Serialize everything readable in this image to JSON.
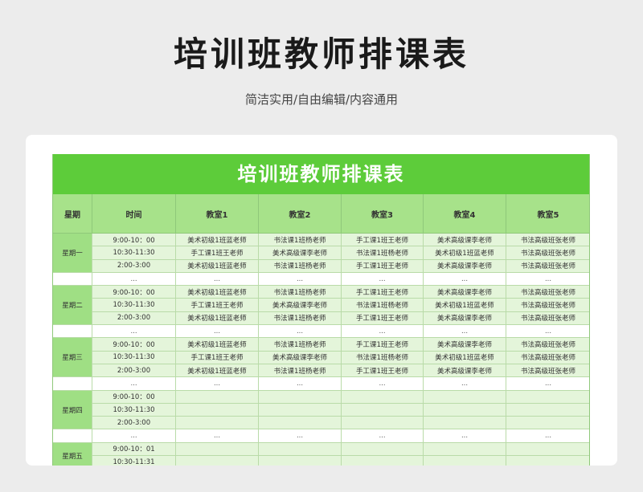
{
  "page": {
    "title": "培训班教师排课表",
    "subtitle": "简洁实用/自由编辑/内容通用"
  },
  "sheet": {
    "banner": "培训班教师排课表",
    "headers": [
      "星期",
      "时间",
      "教室1",
      "教室2",
      "教室3",
      "教室4",
      "教室5"
    ],
    "ellipsis": "...",
    "days": [
      {
        "day": "星期一",
        "rows": [
          {
            "time": "9:00-10：00",
            "cells": [
              "美术初级1班蓝老师",
              "书法课1班杨老师",
              "手工课1班王老师",
              "美术高级课李老师",
              "书法高级班张老师"
            ]
          },
          {
            "time": "10:30-11:30",
            "cells": [
              "手工课1班王老师",
              "美术高级课李老师",
              "书法课1班杨老师",
              "美术初级1班蓝老师",
              "书法高级班张老师"
            ]
          },
          {
            "time": "2:00-3:00",
            "cells": [
              "美术初级1班蓝老师",
              "书法课1班杨老师",
              "手工课1班王老师",
              "美术高级课李老师",
              "书法高级班张老师"
            ]
          }
        ]
      },
      {
        "day": "星期二",
        "rows": [
          {
            "time": "9:00-10：00",
            "cells": [
              "美术初级1班蓝老师",
              "书法课1班杨老师",
              "手工课1班王老师",
              "美术高级课李老师",
              "书法高级班张老师"
            ]
          },
          {
            "time": "10:30-11:30",
            "cells": [
              "手工课1班王老师",
              "美术高级课李老师",
              "书法课1班杨老师",
              "美术初级1班蓝老师",
              "书法高级班张老师"
            ]
          },
          {
            "time": "2:00-3:00",
            "cells": [
              "美术初级1班蓝老师",
              "书法课1班杨老师",
              "手工课1班王老师",
              "美术高级课李老师",
              "书法高级班张老师"
            ]
          }
        ]
      },
      {
        "day": "星期三",
        "rows": [
          {
            "time": "9:00-10：00",
            "cells": [
              "美术初级1班蓝老师",
              "书法课1班杨老师",
              "手工课1班王老师",
              "美术高级课李老师",
              "书法高级班张老师"
            ]
          },
          {
            "time": "10:30-11:30",
            "cells": [
              "手工课1班王老师",
              "美术高级课李老师",
              "书法课1班杨老师",
              "美术初级1班蓝老师",
              "书法高级班张老师"
            ]
          },
          {
            "time": "2:00-3:00",
            "cells": [
              "美术初级1班蓝老师",
              "书法课1班杨老师",
              "手工课1班王老师",
              "美术高级课李老师",
              "书法高级班张老师"
            ]
          }
        ]
      },
      {
        "day": "星期四",
        "rows": [
          {
            "time": "9:00-10：00",
            "cells": [
              "",
              "",
              "",
              "",
              ""
            ]
          },
          {
            "time": "10:30-11:30",
            "cells": [
              "",
              "",
              "",
              "",
              ""
            ]
          },
          {
            "time": "2:00-3:00",
            "cells": [
              "",
              "",
              "",
              "",
              ""
            ]
          }
        ]
      },
      {
        "day": "星期五",
        "rows": [
          {
            "time": "9:00-10：01",
            "cells": [
              "",
              "",
              "",
              "",
              ""
            ]
          },
          {
            "time": "10:30-11:31",
            "cells": [
              "",
              "",
              "",
              "",
              ""
            ]
          }
        ]
      }
    ]
  },
  "colors": {
    "banner": "#5dcc3a",
    "header": "#a7e28a",
    "day_cell": "#9fdf84",
    "slot_cell": "#e4f5da"
  }
}
